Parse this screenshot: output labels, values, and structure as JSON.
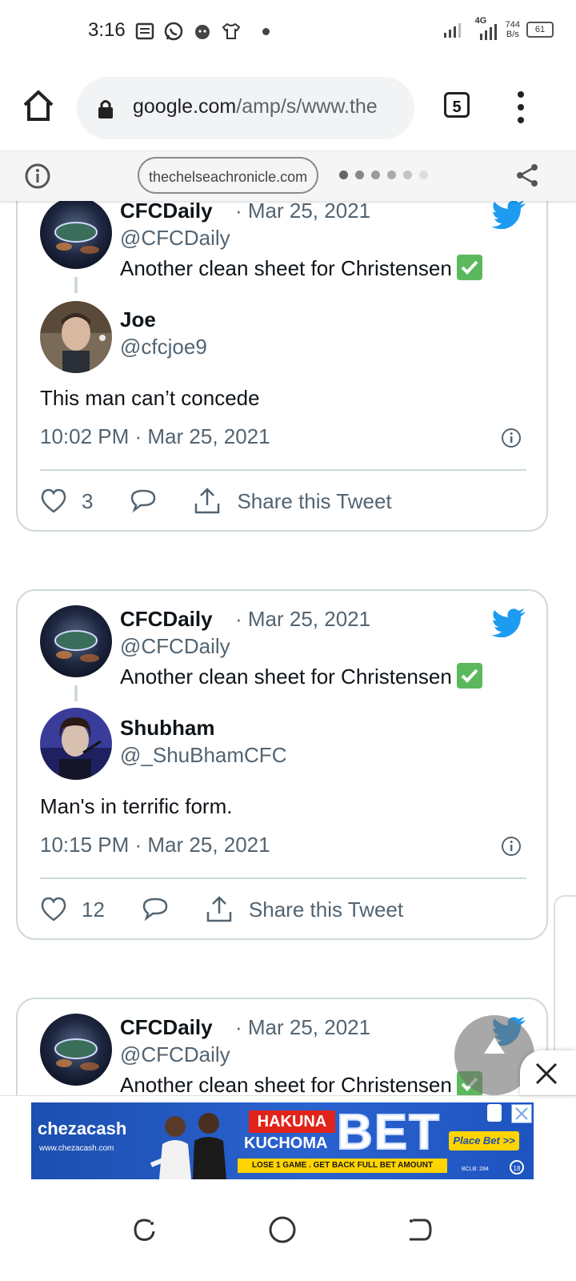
{
  "status_bar": {
    "time": "3:16",
    "network_type": "4G",
    "net_speed_value": "744",
    "net_speed_unit": "B/s",
    "battery": "61"
  },
  "browser": {
    "url_domain": "google.com",
    "url_path": "/amp/s/www.the",
    "tab_count": "5"
  },
  "amp_header": {
    "domain": "thechelseachronicle.com",
    "page_dots": 6,
    "active_dot": 0
  },
  "tweets": [
    {
      "quoted": {
        "name": "CFCDaily",
        "date": "· Mar 25, 2021",
        "handle": "@CFCDaily",
        "text": "Another clean sheet for Christensen"
      },
      "reply": {
        "name": "Joe",
        "handle": "@cfcjoe9",
        "text": "This man can’t concede",
        "timestamp": "10:02 PM · Mar 25, 2021",
        "likes": "3",
        "share_label": "Share this Tweet"
      }
    },
    {
      "quoted": {
        "name": "CFCDaily",
        "date": "· Mar 25, 2021",
        "handle": "@CFCDaily",
        "text": "Another clean sheet for Christensen"
      },
      "reply": {
        "name": "Shubham",
        "handle": "@_ShuBhamCFC",
        "text": "Man's in terrific form.",
        "timestamp": "10:15 PM · Mar 25, 2021",
        "likes": "12",
        "share_label": "Share this Tweet"
      }
    },
    {
      "quoted": {
        "name": "CFCDaily",
        "date": "· Mar 25, 2021",
        "handle": "@CFCDaily",
        "text": "Another clean sheet for Christensen"
      }
    }
  ],
  "ad": {
    "brand": "chezacash",
    "brand_url": "www.chezacash.com",
    "hakuna": "HAKUNA",
    "kuchoma": "KUCHOMA",
    "bet": "BET",
    "tagline": "LOSE 1 GAME . GET BACK FULL BET AMOUNT",
    "cta": "Place Bet >>",
    "license": "BCLB: 284",
    "age": "18"
  },
  "colors": {
    "twitter_blue": "#1d9bf0",
    "secondary_text": "#536471",
    "card_border": "#cfd9de",
    "ad_blue": "#1c4fb0",
    "ad_yellow": "#ffd400"
  }
}
